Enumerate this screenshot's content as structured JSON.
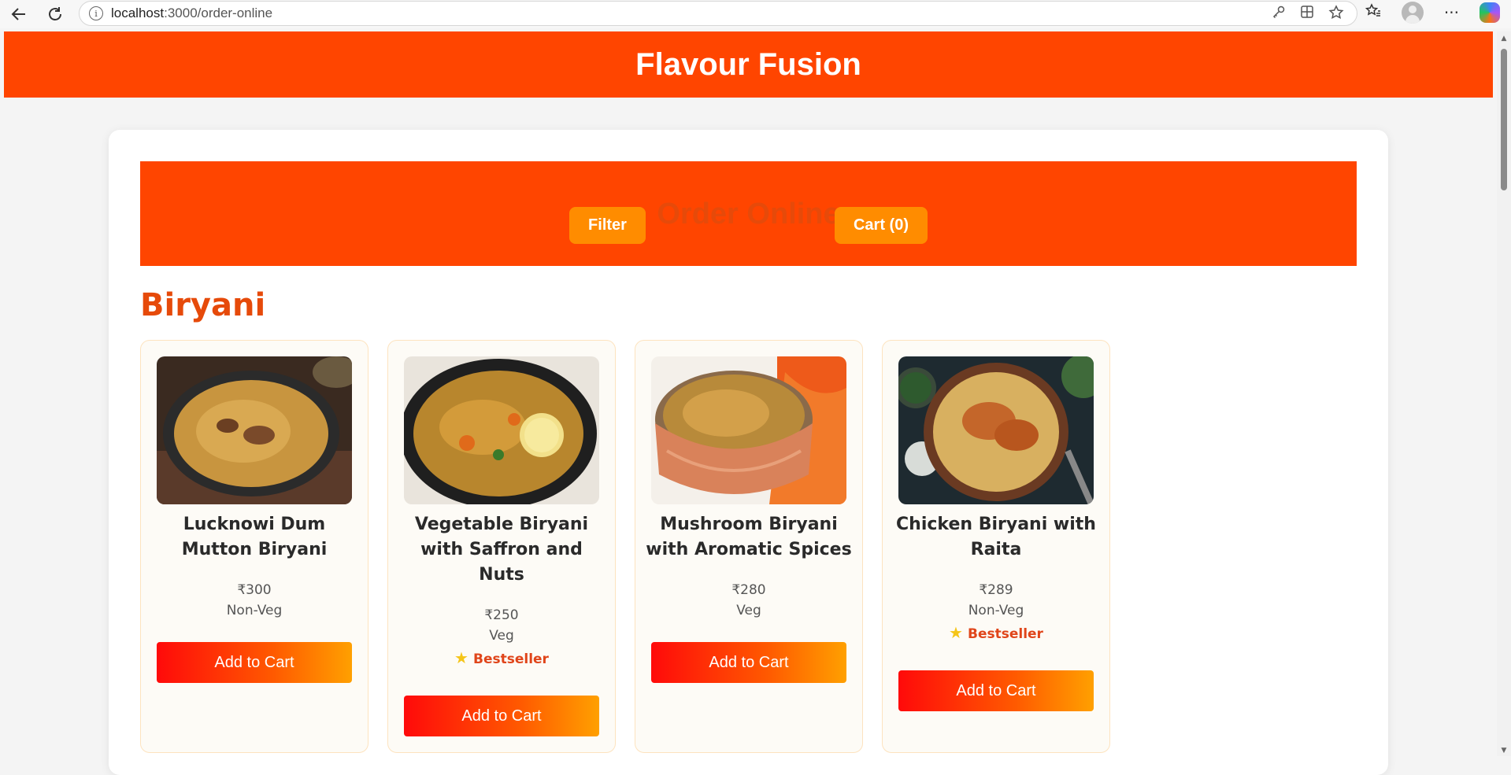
{
  "browser": {
    "url_host": "localhost",
    "url_path": ":3000/order-online"
  },
  "site": {
    "title": "Flavour Fusion"
  },
  "order_bar": {
    "title": "Order Online",
    "filter_label": "Filter",
    "cart_label": "Cart (0)"
  },
  "section": {
    "title": "Biryani"
  },
  "products": [
    {
      "name": "Lucknowi Dum Mutton Biryani",
      "price": "₹300",
      "type": "Non-Veg",
      "badge": "",
      "button": "Add to Cart"
    },
    {
      "name": "Vegetable Biryani with Saffron and Nuts",
      "price": "₹250",
      "type": "Veg",
      "badge": "Bestseller",
      "button": "Add to Cart"
    },
    {
      "name": "Mushroom Biryani with Aromatic Spices",
      "price": "₹280",
      "type": "Veg",
      "badge": "",
      "button": "Add to Cart"
    },
    {
      "name": "Chicken Biryani with Raita",
      "price": "₹289",
      "type": "Non-Veg",
      "badge": "Bestseller",
      "button": "Add to Cart"
    }
  ],
  "colors": {
    "brand": "#ff4500",
    "button_orange": "#ff8c00",
    "accent_text": "#e64a0a"
  }
}
